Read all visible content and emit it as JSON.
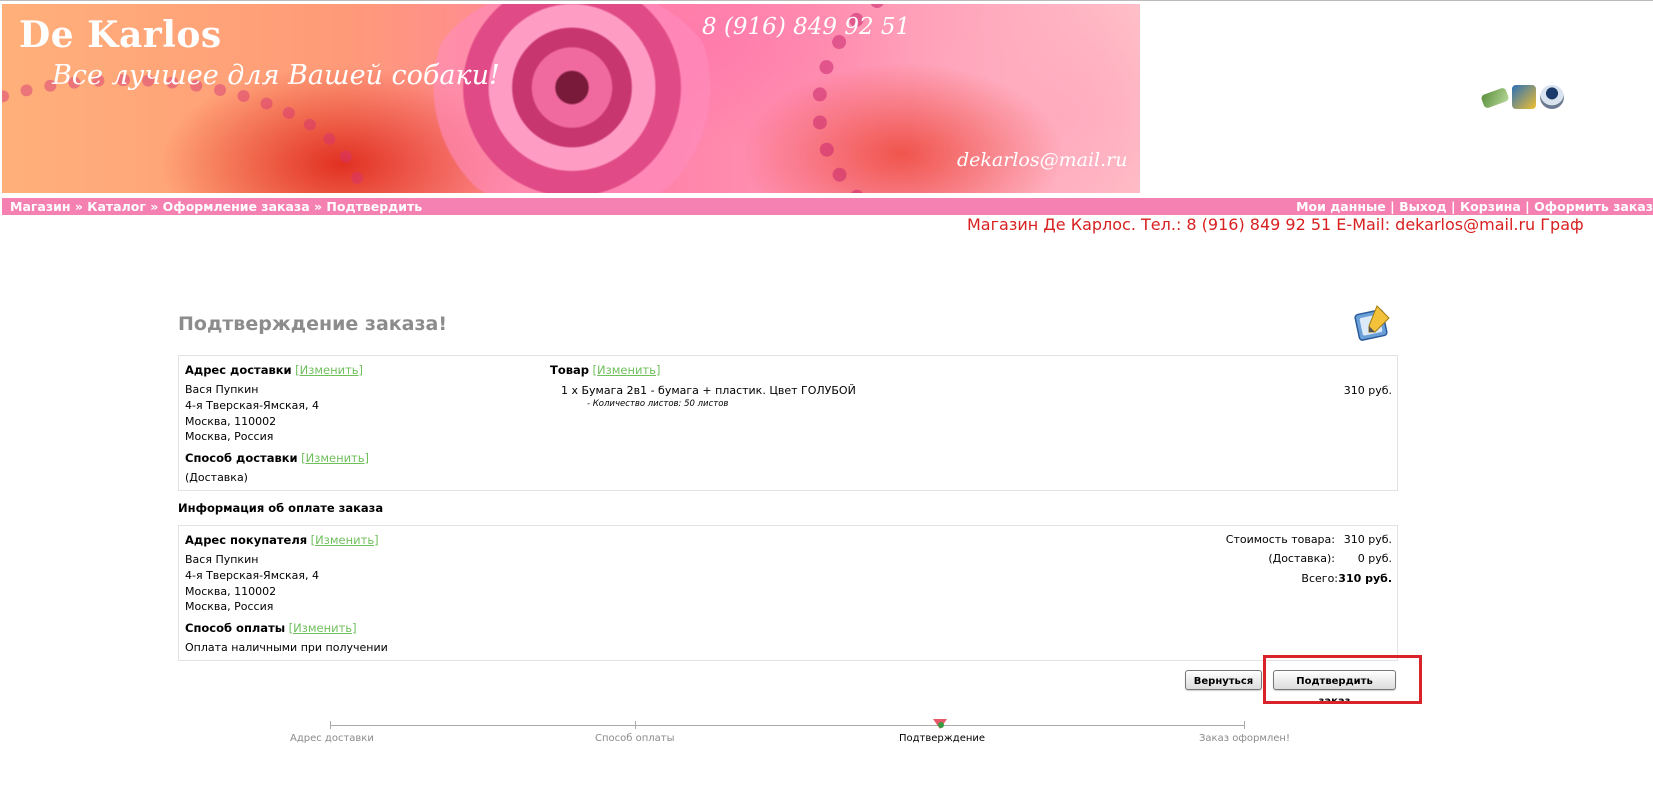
{
  "banner": {
    "title": "De Karlos",
    "subtitle": "Все лучшее для Вашей собаки!",
    "phone": "8 (916) 849 92 51",
    "email": "dekarlos@mail.ru"
  },
  "breadcrumb": {
    "items": [
      "Магазин",
      "Каталог",
      "Оформление заказа",
      "Подтвердить"
    ],
    "separator": " » "
  },
  "top_links": {
    "items": [
      "Мои данные",
      "Выход",
      "Корзина",
      "Оформить заказ"
    ],
    "separator": " | ",
    "icons": [
      "settings-icon",
      "cart-icon",
      "account-icon"
    ]
  },
  "ticker": "Магазин Де Карлос. Тел.: 8 (916) 849 92 51 E-Mail: dekarlos@mail.ru Граф",
  "page_title": "Подтверждение заказа!",
  "change_label": "[Изменить]",
  "delivery": {
    "heading": "Адрес доставки",
    "lines": [
      "Вася Пупкин",
      "4-я Тверская-Ямская, 4",
      "Москва, 110002",
      "Москва, Россия"
    ],
    "method_heading": "Способ доставки",
    "method_value": "(Доставка)"
  },
  "products": {
    "heading": "Товар",
    "item": "1 x Бумага 2в1 - бумага + пластик. Цвет ГОЛУБОЙ",
    "attribute": "- Количество листов: 50 листов",
    "price": "310 руб."
  },
  "payment_info_heading": "Информация об оплате заказа",
  "billing": {
    "heading": "Адрес покупателя",
    "lines": [
      "Вася Пупкин",
      "4-я Тверская-Ямская, 4",
      "Москва, 110002",
      "Москва, Россия"
    ],
    "method_heading": "Способ оплаты",
    "method_value": "Оплата наличными при получении"
  },
  "totals": {
    "subtotal_label": "Стоимость товара:",
    "subtotal_value": "310 руб.",
    "shipping_label": "(Доставка):",
    "shipping_value": "0 руб.",
    "total_label": "Всего:",
    "total_value": "310 руб."
  },
  "buttons": {
    "back": "Вернуться",
    "confirm": "Подтвердить заказ"
  },
  "progress": {
    "steps": [
      "Адрес доставки",
      "Способ оплаты",
      "Подтверждение",
      "Заказ оформлен!"
    ],
    "active_index": 2
  },
  "colors": {
    "nav_bar": "#f581b3",
    "ticker_text": "#d82020",
    "change_link": "#6fbf5c",
    "highlight_box": "#d8232a"
  }
}
